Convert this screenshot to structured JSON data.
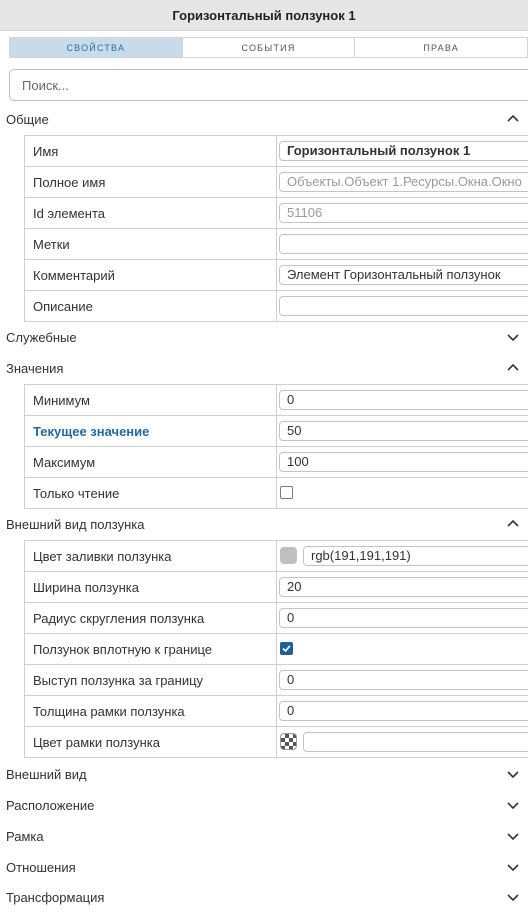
{
  "window": {
    "title": "Горизонтальный ползунок 1"
  },
  "tabs": [
    "СВОЙСТВА",
    "СОБЫТИЯ",
    "ПРАВА"
  ],
  "search": {
    "placeholder": "Поиск..."
  },
  "sections": {
    "general": {
      "label": "Общие",
      "expanded": true,
      "rows": {
        "name": {
          "label": "Имя",
          "value": "Горизонтальный ползунок 1"
        },
        "fullname": {
          "label": "Полное имя",
          "value": "Объекты.Объект 1.Ресурсы.Окна.Окно"
        },
        "id": {
          "label": "Id элемента",
          "value": "51106"
        },
        "tags": {
          "label": "Метки",
          "value": ""
        },
        "comment": {
          "label": "Комментарий",
          "value": "Элемент Горизонтальный ползунок"
        },
        "description": {
          "label": "Описание",
          "value": ""
        }
      }
    },
    "service": {
      "label": "Служебные",
      "expanded": false
    },
    "values": {
      "label": "Значения",
      "expanded": true,
      "rows": {
        "min": {
          "label": "Минимум",
          "value": "0"
        },
        "current": {
          "label": "Текущее значение",
          "value": "50"
        },
        "max": {
          "label": "Максимум",
          "value": "100"
        },
        "readonly": {
          "label": "Только чтение",
          "checked": false
        }
      }
    },
    "thumb": {
      "label": "Внешний вид ползунка",
      "expanded": true,
      "rows": {
        "fill": {
          "label": "Цвет заливки ползунка",
          "value": "rgb(191,191,191)",
          "swatch": "#bfbfbf"
        },
        "width": {
          "label": "Ширина ползунка",
          "value": "20"
        },
        "radius": {
          "label": "Радиус скругления ползунка",
          "value": "0"
        },
        "tight": {
          "label": "Ползунок вплотную к границе",
          "checked": true
        },
        "overhang": {
          "label": "Выступ ползунка за границу",
          "value": "0"
        },
        "border_width": {
          "label": "Толщина рамки ползунка",
          "value": "0"
        },
        "border_color": {
          "label": "Цвет рамки ползунка",
          "value": ""
        }
      }
    },
    "appearance": {
      "label": "Внешний вид",
      "expanded": false
    },
    "layout": {
      "label": "Расположение",
      "expanded": false
    },
    "frame": {
      "label": "Рамка",
      "expanded": false
    },
    "relations": {
      "label": "Отношения",
      "expanded": false
    },
    "transform": {
      "label": "Трансформация",
      "expanded": false
    }
  },
  "colors": {
    "accent": "#1e5f96",
    "tab_active_bg": "#c7dcea",
    "highlight_label": "#1f6aa5"
  }
}
